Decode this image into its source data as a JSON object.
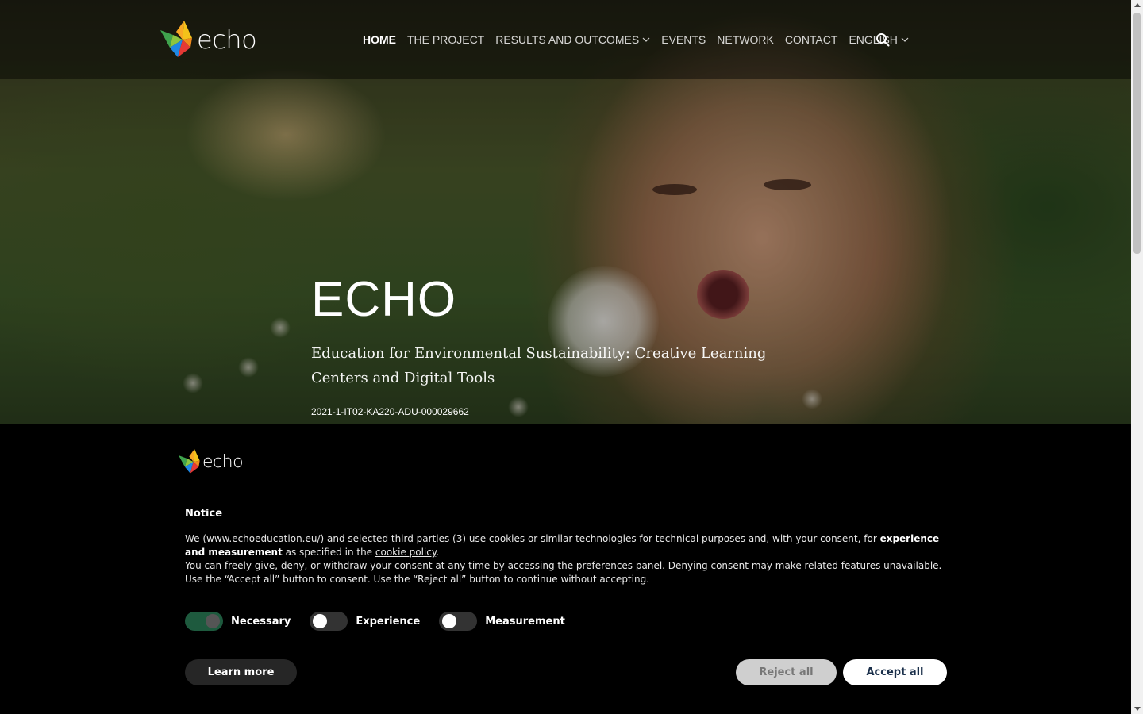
{
  "brand": {
    "name": "echo"
  },
  "nav": {
    "items": [
      {
        "label": "HOME",
        "active": true,
        "dropdown": false
      },
      {
        "label": "THE PROJECT",
        "active": false,
        "dropdown": false
      },
      {
        "label": "RESULTS AND OUTCOMES",
        "active": false,
        "dropdown": true
      },
      {
        "label": "EVENTS",
        "active": false,
        "dropdown": false
      },
      {
        "label": "NETWORK",
        "active": false,
        "dropdown": false
      },
      {
        "label": "CONTACT",
        "active": false,
        "dropdown": false
      },
      {
        "label": "ENGLISH",
        "active": false,
        "dropdown": true
      }
    ],
    "search_icon": "search-icon"
  },
  "hero": {
    "title": "ECHO",
    "subtitle": "Education for Environmental Sustainability: Creative Learning Centers and Digital Tools",
    "code": "2021-1-IT02-KA220-ADU-000029662"
  },
  "cookie": {
    "logo_text": "echo",
    "title": "Notice",
    "body_1": "We (www.echoeducation.eu/) and selected third parties (3) use cookies or similar technologies for technical purposes and, with your consent, for ",
    "body_bold": "experience and measurement",
    "body_2": " as specified in the ",
    "body_link": "cookie policy",
    "body_3": ".",
    "body_4": "You can freely give, deny, or withdraw your consent at any time by accessing the preferences panel. Denying consent may make related features unavailable.",
    "body_5": "Use the “Accept all” button to consent. Use the “Reject all” button to continue without accepting.",
    "toggles": [
      {
        "label": "Necessary",
        "on": true
      },
      {
        "label": "Experience",
        "on": false
      },
      {
        "label": "Measurement",
        "on": false
      }
    ],
    "learn_more": "Learn more",
    "reject_all": "Reject all",
    "accept_all": "Accept all"
  },
  "colors": {
    "accept_text": "#1a2f4a",
    "toggle_on": "#1e5a3e"
  }
}
